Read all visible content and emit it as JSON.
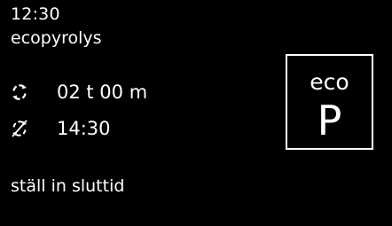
{
  "status": {
    "time": "12:30",
    "program": "ecopyrolys"
  },
  "settings": {
    "duration": {
      "icon": "cycle-arrows-icon",
      "value": "02 t 00 m"
    },
    "end_time": {
      "icon": "cycle-arrows-crossed-icon",
      "value": "14:30"
    }
  },
  "prompt": "ställ in sluttid",
  "mode_badge": {
    "label": "eco",
    "letter": "P"
  },
  "colors": {
    "background": "#000000",
    "foreground": "#ffffff"
  }
}
